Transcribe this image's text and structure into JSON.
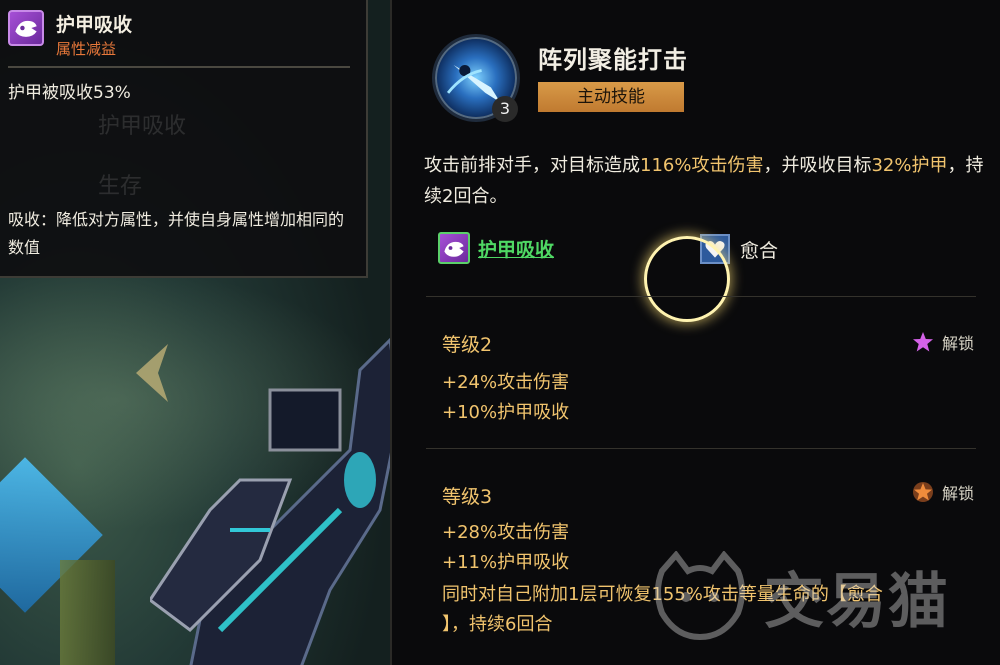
{
  "tooltip": {
    "title": "护甲吸收",
    "subtitle": "属性减益",
    "effect": "护甲被吸收53%",
    "ghost_items": [
      "护甲吸收",
      "生存"
    ],
    "description": "吸收：降低对方属性，并使自身属性增加相同的数值"
  },
  "skill": {
    "name": "阵列聚能打击",
    "level_badge": "3",
    "type_label": "主动技能",
    "desc_parts": [
      "攻击前排对手，对目标造成",
      "116%攻击伤害",
      "，并吸收目标",
      "32%护甲",
      "，持续2回合。"
    ],
    "tags": {
      "armor_absorb": "护甲吸收",
      "heal": "愈合"
    }
  },
  "levels": [
    {
      "title": "等级2",
      "lines": [
        "+24%攻击伤害",
        "+10%护甲吸收"
      ],
      "unlock_label": "解锁",
      "unlock_icon": "purple-star-icon"
    },
    {
      "title": "等级3",
      "lines": [
        "+28%攻击伤害",
        "+11%护甲吸收",
        "同时对自己附加1层可恢复155%攻击等量生命的【愈合",
        "】，持续6回合"
      ],
      "unlock_label": "解锁",
      "unlock_icon": "orange-star-icon"
    }
  ],
  "colors": {
    "gold_text": "#f1c46e",
    "green_link": "#4fd864",
    "debuff_orange": "#e8783a",
    "type_badge": "#d89a48"
  },
  "watermark": "交易猫"
}
